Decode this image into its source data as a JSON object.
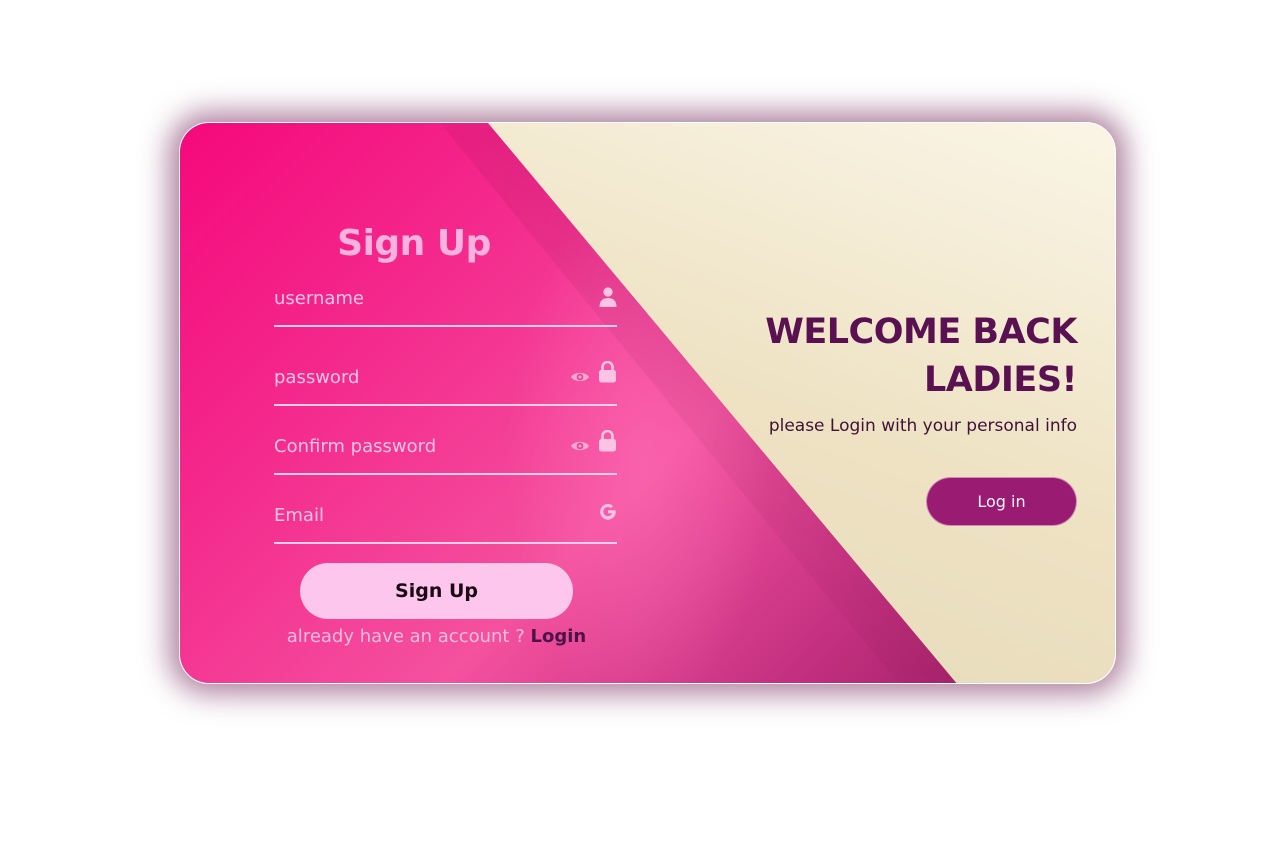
{
  "signup": {
    "title": "Sign Up",
    "fields": [
      {
        "placeholder": "username",
        "icon": "user-icon"
      },
      {
        "placeholder": "password",
        "icons": [
          "eye-icon",
          "lock-icon"
        ]
      },
      {
        "placeholder": "Confirm password",
        "icons": [
          "eye-icon",
          "lock-icon"
        ]
      },
      {
        "placeholder": "Email",
        "icon": "google-icon"
      }
    ],
    "button_label": "Sign Up",
    "switch_text": "already have an account ? ",
    "switch_link": "Login"
  },
  "welcome": {
    "title": "WELCOME BACK LADIES!",
    "subtitle": "please Login with your personal info",
    "button_label": "Log in"
  },
  "colors": {
    "pink_primary": "#f5097b",
    "pink_light": "#fdc6ec",
    "cream": "#efe5c9",
    "plum": "#5a1152",
    "login_button": "#9a1b72"
  }
}
